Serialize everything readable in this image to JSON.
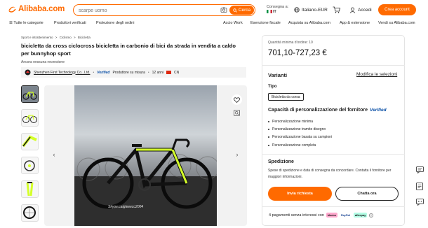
{
  "header": {
    "logo_text": "Alibaba.com",
    "search_placeholder": "scarpe uomo",
    "search_button": "Cerca",
    "ship_to_label": "Consegna a:",
    "ship_to_country": "IT",
    "language": "Italiano-EUR",
    "login": "Accedi",
    "create_account": "Crea account"
  },
  "nav": {
    "categories": "Tutte le categorie",
    "items_left": [
      "Produttori verificati",
      "Protezione degli ordini"
    ],
    "items_right": [
      "Accio Work",
      "Esenzione fiscale",
      "Acquista su Alibaba.com",
      "App & estensione",
      "Vendi su Alibaba.com"
    ]
  },
  "breadcrumb": [
    "Sport e intrattenimento",
    ">",
    "Ciclismo",
    ">",
    "Bicicletta"
  ],
  "product": {
    "title": "bicicletta da cross ciclocross bicicletta in carbonio di bici da strada in vendita a caldo per bunnyhop sport",
    "reviews": "Ancora nessuna recensione",
    "supplier_name": "Shenzhen First Technology Co., Ltd.",
    "verified_label": "Verified",
    "supplier_custom": "Produttore su misura",
    "years": "12 anni",
    "country": "CN",
    "watermark": "Skype:caigleeecc2004"
  },
  "panel": {
    "min_qty": "Quantità minima d'ordine: 10",
    "price": "701,10-727,23 €",
    "variants_title": "Varianti",
    "variants_edit": "Modifica le selezioni",
    "tipo_label": "Tipo",
    "tipo_value": "Bicicletta da corsa",
    "custom_title": "Capacità di personalizzazione del fornitore",
    "custom_verified": "Verified",
    "custom_items": [
      "Personalizzazione minima",
      "Personalizzazione tramite disegno",
      "Personalizzazione basata su campioni",
      "Personalizzazione completa"
    ],
    "shipping_title": "Spedizione",
    "shipping_text": "Spese di spedizione e data di consegna da concordare. Contatta il fornitore per maggiori informazioni.",
    "inquiry_button": "Invia richiesta",
    "chat_button": "Chatta ora",
    "payments_text": "4 pagamenti senza interessi con",
    "klarna": "klarna",
    "paypal": "PayPal",
    "afterpay": "afterpay"
  },
  "colors": {
    "accent": "#ff6a00",
    "verified": "#0a4fa6"
  }
}
